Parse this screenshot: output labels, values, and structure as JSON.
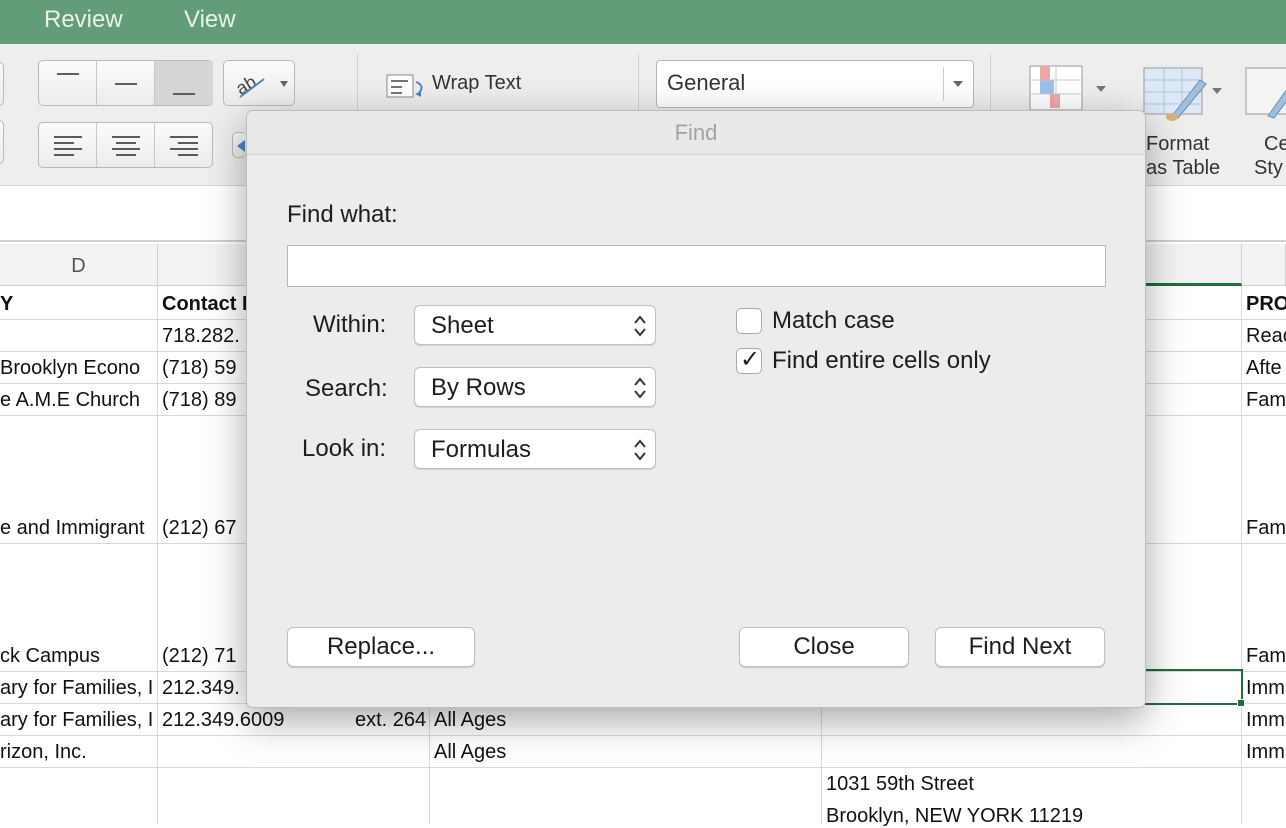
{
  "ribbon_tabs": [
    "Review",
    "View"
  ],
  "ribbon": {
    "wrap_text": "Wrap Text",
    "number_format": "General",
    "format_table_line1": "Format",
    "format_table_line2": "as Table",
    "cell_styles_line1": "Ce",
    "cell_styles_line2": "Sty"
  },
  "grid": {
    "column_d": "D",
    "header_cells": [
      "Y",
      "Contact I",
      "PRO"
    ],
    "rows": [
      {
        "c1": "",
        "c2": "718.282.",
        "c3": "",
        "c4": "",
        "c5": "Reac"
      },
      {
        "c1": "Brooklyn Econo",
        "c2": "(718) 59",
        "c3": "",
        "c4": "",
        "c5": "Afte"
      },
      {
        "c1": "e A.M.E Church",
        "c2": "(718) 89",
        "c3": "",
        "c4": "",
        "c5": "Fam"
      },
      {
        "c1": "e and Immigrant",
        "c2": "(212) 67",
        "c3": "",
        "c4": "",
        "c5": "Fam"
      },
      {
        "c1": "ck Campus",
        "c2": "(212) 71",
        "c3": "",
        "c4": "",
        "c5": "Fam"
      },
      {
        "c1": "ary for Families, I",
        "c2": "212.349.",
        "c3": "",
        "c4": "",
        "c5": "Imm"
      },
      {
        "c1": "ary for Families, I",
        "c2": "212.349.6009",
        "c2b": "ext. 264",
        "c3": "All Ages",
        "c4": "",
        "c5": "Imm"
      },
      {
        "c1": "rizon, Inc.",
        "c2": "",
        "c3": "All Ages",
        "c4": "",
        "c5": "Imm"
      },
      {
        "c1": "",
        "c2": "",
        "c3": "",
        "c4a": "1031 59th Street",
        "c4b": "Brooklyn, NEW YORK 11219",
        "c5": ""
      }
    ]
  },
  "dialog": {
    "title": "Find",
    "find_what_label": "Find what:",
    "find_what_value": "",
    "within_label": "Within:",
    "within_value": "Sheet",
    "search_label": "Search:",
    "search_value": "By Rows",
    "look_in_label": "Look in:",
    "look_in_value": "Formulas",
    "match_case_label": "Match case",
    "match_case_checked": false,
    "entire_cells_label": "Find entire cells only",
    "entire_cells_checked": true,
    "checkmark_glyph": "✓",
    "replace_button": "Replace...",
    "close_button": "Close",
    "find_next_button": "Find Next"
  },
  "colors": {
    "tab_strip": "#639c79",
    "selection": "#1e6e3c",
    "dialog_bg": "#ececec"
  }
}
